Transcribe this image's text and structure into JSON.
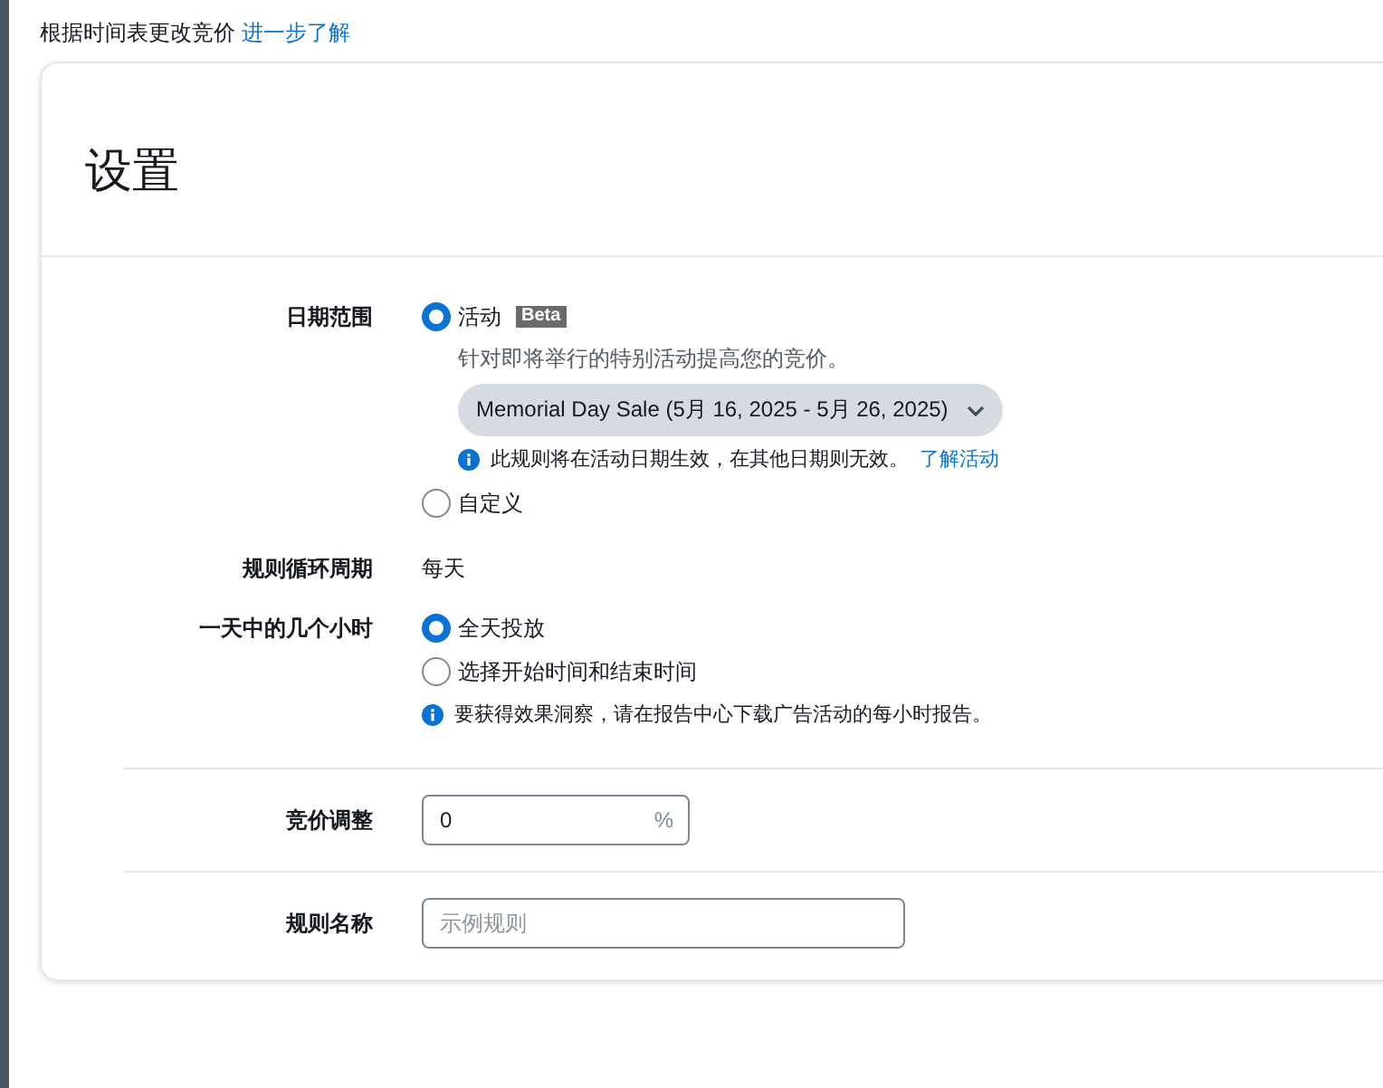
{
  "header": {
    "text": "根据时间表更改竞价",
    "link": "进一步了解"
  },
  "settings": {
    "title": "设置",
    "date_range": {
      "label": "日期范围",
      "options": [
        {
          "kind": "event",
          "label": "活动",
          "badge": "Beta",
          "selected": true,
          "description": "针对即将举行的特别活动提高您的竞价。",
          "dropdown": "Memorial Day Sale (5月 16, 2025 - 5月 26, 2025)",
          "note": "此规则将在活动日期生效，在其他日期则无效。",
          "note_link": "了解活动"
        },
        {
          "label": "自定义",
          "selected": false
        }
      ]
    },
    "recurrence": {
      "label": "规则循环周期",
      "value": "每天"
    },
    "hours": {
      "label": "一天中的几个小时",
      "options": [
        {
          "label": "全天投放",
          "selected": true
        },
        {
          "label": "选择开始时间和结束时间",
          "selected": false
        }
      ],
      "note": "要获得效果洞察，请在报告中心下载广告活动的每小时报告。"
    },
    "bid_adjustment": {
      "label": "竞价调整",
      "value": "0",
      "unit": "%"
    },
    "rule_name": {
      "label": "规则名称",
      "placeholder": "示例规则"
    }
  }
}
